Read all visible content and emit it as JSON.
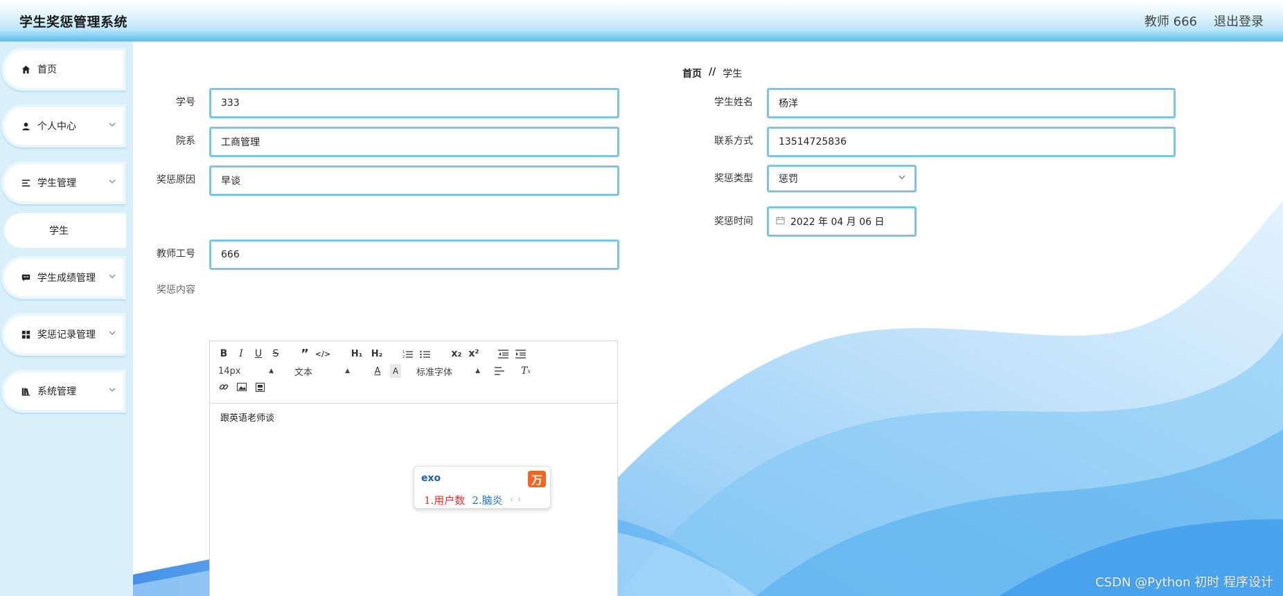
{
  "header": {
    "title": "学生奖惩管理系统",
    "user": "教师 666",
    "logout": "退出登录"
  },
  "sidebar": {
    "items": [
      {
        "label": "首页"
      },
      {
        "label": "个人中心"
      },
      {
        "label": "学生管理"
      },
      {
        "label": "学生成绩管理"
      },
      {
        "label": "奖惩记录管理"
      },
      {
        "label": "系统管理"
      }
    ],
    "sub_student": "学生"
  },
  "breadcrumb": {
    "home": "首页",
    "sep": "//",
    "current": "学生"
  },
  "form": {
    "student_no": {
      "label": "学号",
      "value": "333"
    },
    "student_name": {
      "label": "学生姓名",
      "value": "杨洋"
    },
    "department": {
      "label": "院系",
      "value": "工商管理"
    },
    "contact": {
      "label": "联系方式",
      "value": "13514725836"
    },
    "reason": {
      "label": "奖惩原因",
      "value": "早谈"
    },
    "type": {
      "label": "奖惩类型",
      "value": "惩罚"
    },
    "time": {
      "label": "奖惩时间",
      "value": "2022 年 04 月 06 日"
    },
    "teacher_no": {
      "label": "教师工号",
      "value": "666"
    },
    "content": {
      "label": "奖惩内容",
      "value": "跟英语老师谈"
    }
  },
  "editor": {
    "font_size": "14px",
    "text_type": "文本",
    "font_family": "标准字体"
  },
  "ime": {
    "input": "exo",
    "candidate1": "1.用户数",
    "candidate2": "2.脑炎",
    "badge": "万",
    "arrows": "‹ ›"
  },
  "watermark": "CSDN @Python 初时 程序设计",
  "colors": {
    "accent": "#7ec4e3",
    "header_bottom": "#58c0ee",
    "sidebar_bg": "#d9eff9"
  }
}
